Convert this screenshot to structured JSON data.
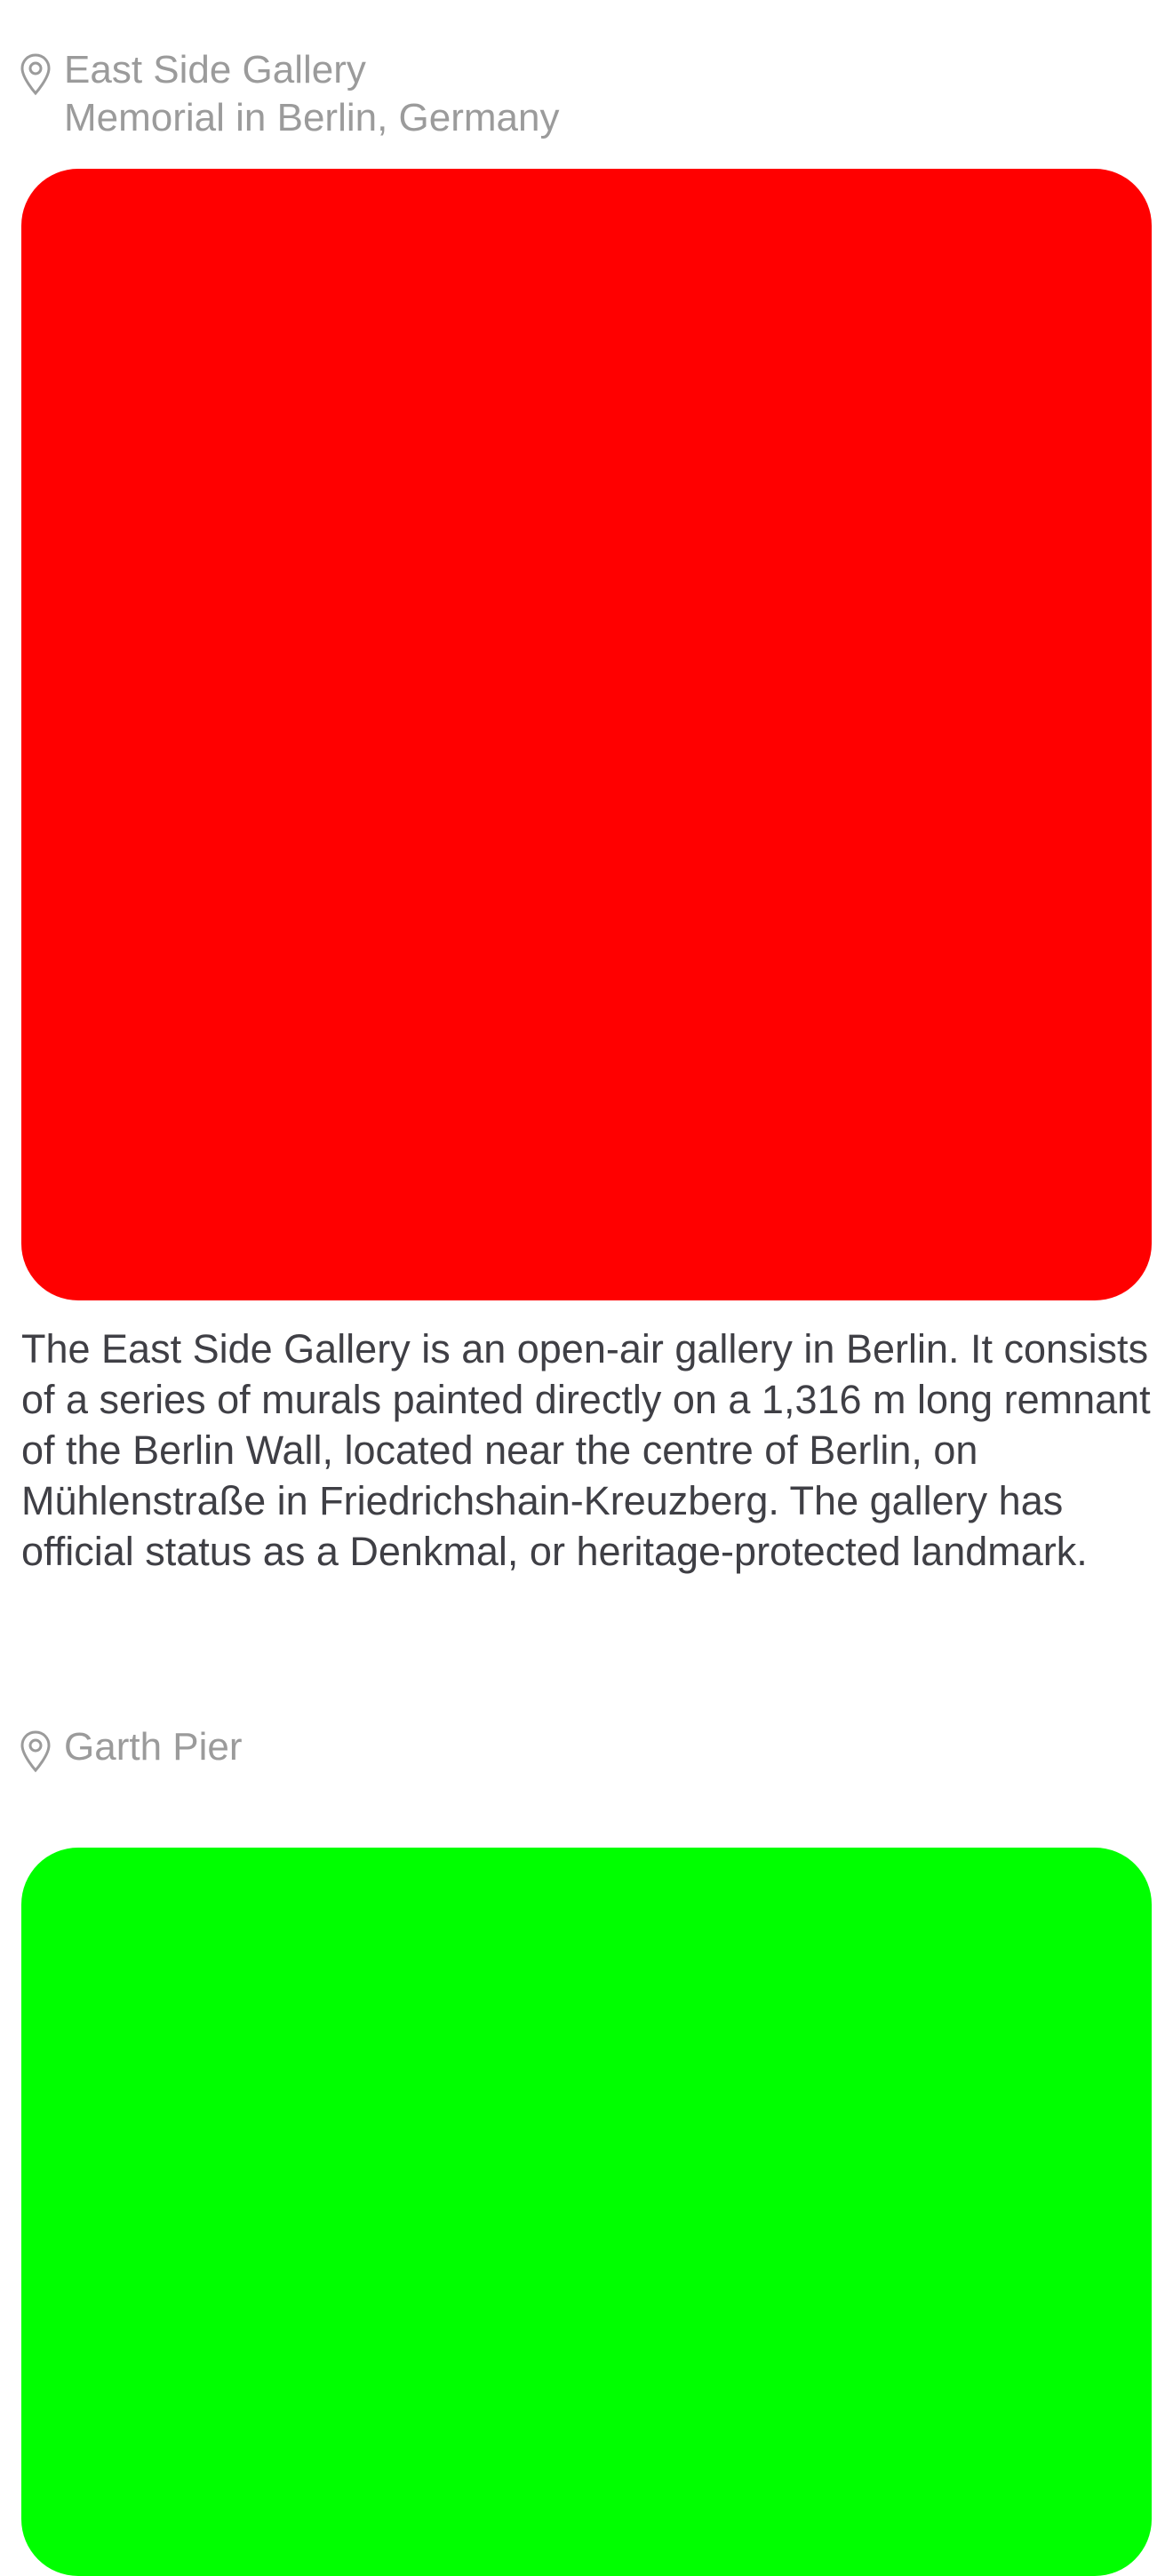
{
  "cards": [
    {
      "place_name": "East Side Gallery",
      "place_subtitle": "Memorial in Berlin, Germany",
      "photo_color": "#ff0000",
      "description": "The East Side Gallery is an open-air gallery in Berlin. It consists of a series of murals painted directly on a 1,316 m long remnant of the Berlin Wall, located near the centre of Berlin, on Mühlenstraße in Friedrichshain-Kreuzberg. The gallery has official status as a Denkmal, or heritage-protected landmark."
    },
    {
      "place_name": "Garth Pier",
      "photo_color": "#00ff00"
    }
  ],
  "icons": {
    "location": "map-pin-icon"
  },
  "colors": {
    "secondary_text": "#9b9b9b",
    "body_text": "#3f3f45",
    "background": "#ffffff"
  }
}
